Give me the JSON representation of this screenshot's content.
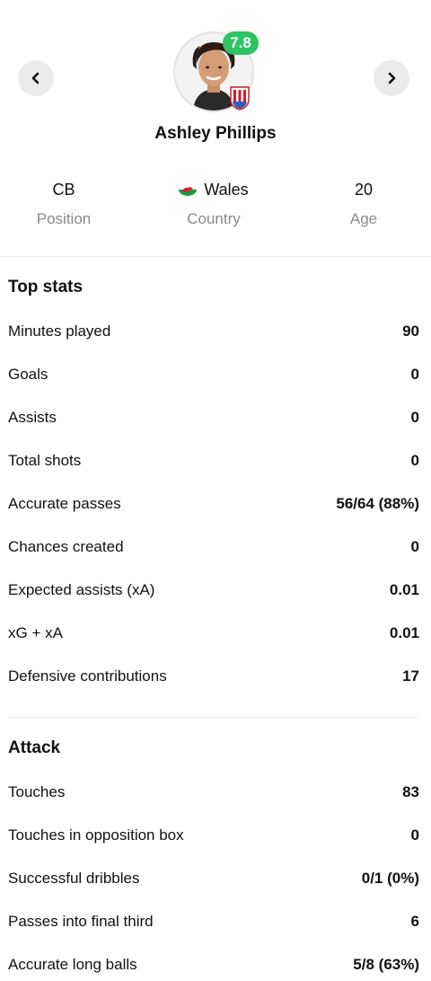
{
  "player": {
    "name": "Ashley Phillips",
    "rating": "7.8",
    "rating_color": "#2ec461"
  },
  "nav": {
    "prev_icon": "chevron-left-icon",
    "next_icon": "chevron-right-icon"
  },
  "info": {
    "position": {
      "value": "CB",
      "label": "Position"
    },
    "country": {
      "value": "Wales",
      "label": "Country",
      "flag_icon": "wales-flag-icon"
    },
    "age": {
      "value": "20",
      "label": "Age"
    }
  },
  "top_stats": {
    "title": "Top stats",
    "rows": [
      {
        "label": "Minutes played",
        "value": "90"
      },
      {
        "label": "Goals",
        "value": "0"
      },
      {
        "label": "Assists",
        "value": "0"
      },
      {
        "label": "Total shots",
        "value": "0"
      },
      {
        "label": "Accurate passes",
        "value": "56/64 (88%)"
      },
      {
        "label": "Chances created",
        "value": "0"
      },
      {
        "label": "Expected assists (xA)",
        "value": "0.01"
      },
      {
        "label": "xG + xA",
        "value": "0.01"
      },
      {
        "label": "Defensive contributions",
        "value": "17"
      }
    ]
  },
  "attack": {
    "title": "Attack",
    "rows": [
      {
        "label": "Touches",
        "value": "83"
      },
      {
        "label": "Touches in opposition box",
        "value": "0"
      },
      {
        "label": "Successful dribbles",
        "value": "0/1 (0%)"
      },
      {
        "label": "Passes into final third",
        "value": "6"
      },
      {
        "label": "Accurate long balls",
        "value": "5/8 (63%)"
      }
    ]
  }
}
